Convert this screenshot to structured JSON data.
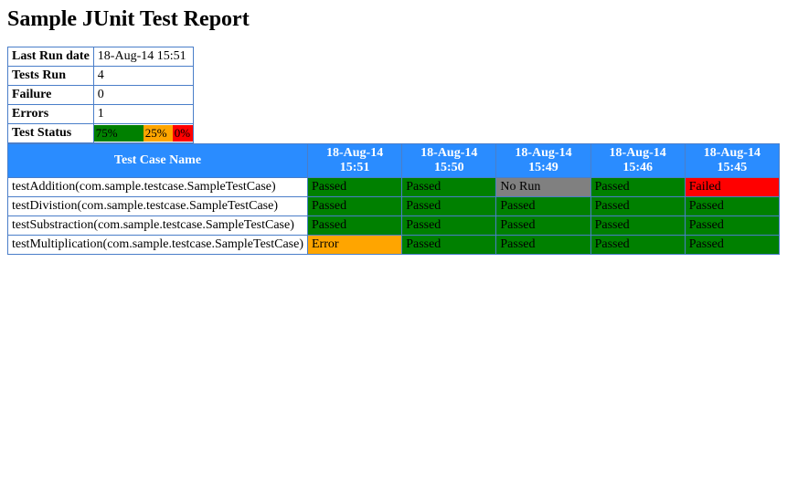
{
  "title": "Sample JUnit Test Report",
  "summary": {
    "rows": [
      {
        "label": "Last Run date",
        "value": "18-Aug-14 15:51"
      },
      {
        "label": "Tests Run",
        "value": "4"
      },
      {
        "label": "Failure",
        "value": "0"
      },
      {
        "label": "Errors",
        "value": "1"
      }
    ],
    "status_label": "Test Status",
    "status_segments": [
      {
        "label": "75%",
        "class": "seg-green",
        "width": 50
      },
      {
        "label": "25%",
        "class": "seg-orange",
        "width": 28
      },
      {
        "label": "0%",
        "class": "seg-red",
        "width": 18
      }
    ]
  },
  "results": {
    "header_first": "Test Case Name",
    "columns": [
      "18-Aug-14 15:51",
      "18-Aug-14 15:50",
      "18-Aug-14 15:49",
      "18-Aug-14 15:46",
      "18-Aug-14 15:45"
    ],
    "rows": [
      {
        "name": "testAddition(com.sample.testcase.SampleTestCase)",
        "cells": [
          {
            "value": "Passed",
            "class": "passed"
          },
          {
            "value": "Passed",
            "class": "passed"
          },
          {
            "value": "No Run",
            "class": "norun"
          },
          {
            "value": "Passed",
            "class": "passed"
          },
          {
            "value": "Failed",
            "class": "failed"
          }
        ]
      },
      {
        "name": "testDivistion(com.sample.testcase.SampleTestCase)",
        "cells": [
          {
            "value": "Passed",
            "class": "passed"
          },
          {
            "value": "Passed",
            "class": "passed"
          },
          {
            "value": "Passed",
            "class": "passed"
          },
          {
            "value": "Passed",
            "class": "passed"
          },
          {
            "value": "Passed",
            "class": "passed"
          }
        ]
      },
      {
        "name": "testSubstraction(com.sample.testcase.SampleTestCase)",
        "cells": [
          {
            "value": "Passed",
            "class": "passed"
          },
          {
            "value": "Passed",
            "class": "passed"
          },
          {
            "value": "Passed",
            "class": "passed"
          },
          {
            "value": "Passed",
            "class": "passed"
          },
          {
            "value": "Passed",
            "class": "passed"
          }
        ]
      },
      {
        "name": "testMultiplication(com.sample.testcase.SampleTestCase)",
        "cells": [
          {
            "value": "Error",
            "class": "error"
          },
          {
            "value": "Passed",
            "class": "passed"
          },
          {
            "value": "Passed",
            "class": "passed"
          },
          {
            "value": "Passed",
            "class": "passed"
          },
          {
            "value": "Passed",
            "class": "passed"
          }
        ]
      }
    ]
  }
}
